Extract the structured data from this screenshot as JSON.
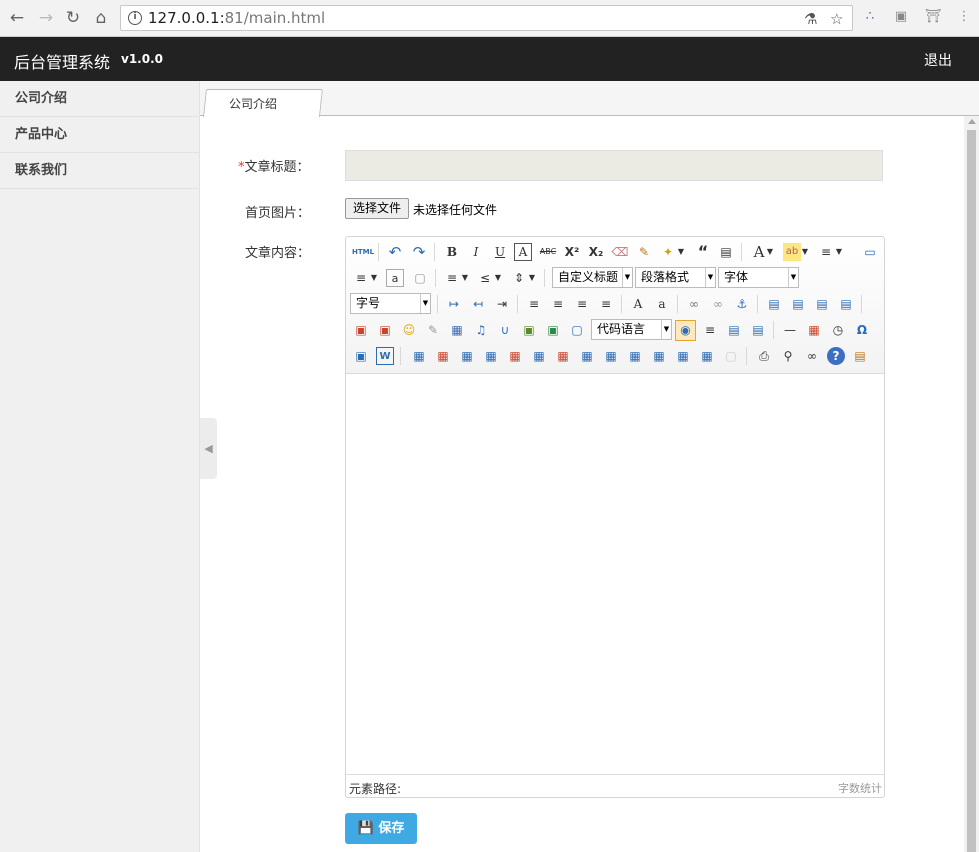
{
  "browser": {
    "url_host": "127.0.0.1:",
    "url_port": "81",
    "url_path": "/main.html"
  },
  "app": {
    "title": "后台管理系统",
    "version": "v1.0.0",
    "logout": "退出"
  },
  "sidebar": {
    "items": [
      {
        "label": "公司介绍"
      },
      {
        "label": "产品中心"
      },
      {
        "label": "联系我们"
      }
    ]
  },
  "tabs": [
    {
      "label": "公司介绍"
    }
  ],
  "form": {
    "title_label": "文章标题：",
    "required_mark": "*",
    "image_label": "首页图片：",
    "file_button": "选择文件",
    "file_status": "未选择任何文件",
    "content_label": "文章内容："
  },
  "editor": {
    "custom_heading": "自定义标题",
    "paragraph": "段落格式",
    "font_family": "字体",
    "font_size": "字号",
    "code_language": "代码语言",
    "element_path": "元素路径:",
    "word_count": "字数统计",
    "html_label": "HTML"
  },
  "save_button": "保存"
}
